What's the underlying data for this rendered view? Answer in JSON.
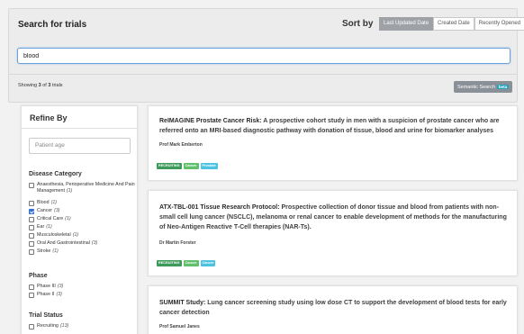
{
  "header": {
    "title": "Search for trials",
    "sort_by_label": "Sort by",
    "sort_options": [
      "Last Updated Date",
      "Created Date",
      "Recently Opened"
    ],
    "active_sort": "Last Updated Date"
  },
  "search": {
    "value": "blood"
  },
  "results": {
    "showing_prefix": "Showing ",
    "showing_count": "3",
    "showing_middle": " of ",
    "showing_total": "3",
    "showing_suffix": " trials",
    "semantic_search_label": "Semantic Search",
    "beta_label": "beta"
  },
  "sidebar": {
    "title": "Refine By",
    "age_placeholder": "Patient age",
    "disease_category": {
      "title": "Disease Category",
      "items": [
        {
          "label": "Anaesthesia, Perioperative Medicine And Pain Management",
          "count": "(1)",
          "checked": false
        },
        {
          "label": "Blood",
          "count": "(1)",
          "checked": false
        },
        {
          "label": "Cancer",
          "count": "(3)",
          "checked": true
        },
        {
          "label": "Critical Care",
          "count": "(1)",
          "checked": false
        },
        {
          "label": "Ear",
          "count": "(1)",
          "checked": false
        },
        {
          "label": "Musculoskeletal",
          "count": "(1)",
          "checked": false
        },
        {
          "label": "Oral And Gastrointestinal",
          "count": "(3)",
          "checked": false
        },
        {
          "label": "Stroke",
          "count": "(1)",
          "checked": false
        }
      ]
    },
    "phase": {
      "title": "Phase",
      "items": [
        {
          "label": "Phase III",
          "count": "(3)",
          "checked": false
        },
        {
          "label": "Phase II",
          "count": "(3)",
          "checked": false
        }
      ]
    },
    "trial_status": {
      "title": "Trial Status",
      "items": [
        {
          "label": "Recruiting",
          "count": "(13)",
          "checked": false
        }
      ]
    }
  },
  "trials": [
    {
      "short": "ReIMAGINE Prostate Cancer Risk:",
      "rest": "  A prospective cohort study in men with a suspicion of prostate cancer who are referred onto an MRI-based diagnostic pathway with donation of tissue, blood and urine for biomarker analyses",
      "author": "Prof Mark Emberton",
      "tags": [
        "RECRUITING",
        "Cancer",
        "Prostate"
      ]
    },
    {
      "short": "ATX-TBL-001 Tissue Research Protocol:",
      "rest": "  Prospective collection of donor tissue and blood from patients with non-small cell lung cancer (NSCLC), melanoma or renal cancer to enable development of methods for the manufacturing of Neo-Antigen Reactive T-Cell therapies (NAR-Ts).",
      "author": "Dr Martin Forster",
      "tags": [
        "RECRUITING",
        "Cancer",
        "Cancer"
      ]
    },
    {
      "short": "SUMMIT Study:",
      "rest": "  Lung cancer screening study using low dose CT to support the development of blood tests for early cancer detection",
      "author": "Prof Samuel Janes",
      "tags": []
    }
  ],
  "colors": {
    "recruiting_tag": "#3d9a5b",
    "category_tag": "#5fbf6a",
    "subcategory_tag": "#4cc3e0",
    "checkbox_checked": "#2f6fd6",
    "beta_badge": "#24a2b8"
  }
}
